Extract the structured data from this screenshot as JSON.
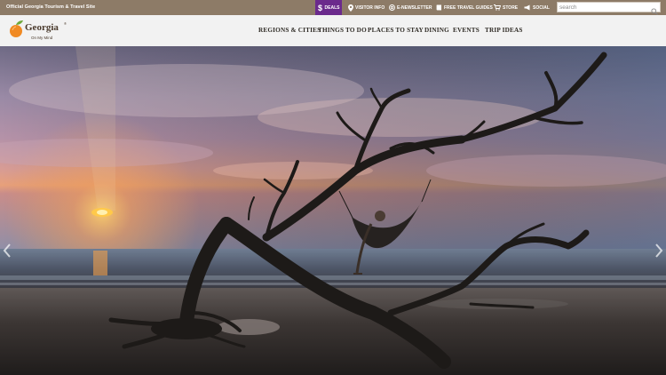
{
  "topbar": {
    "tagline": "Official Georgia Tourism & Travel Site",
    "links": {
      "deals": "DEALS",
      "visitor_info": "VISITOR INFO",
      "enewsletter": "E-NEWSLETTER",
      "travel_guides": "FREE TRAVEL GUIDES",
      "store": "STORE",
      "social": "SOCIAL"
    },
    "search": {
      "placeholder": "search",
      "value": ""
    }
  },
  "brand": {
    "name": "Georgia",
    "registered": "®",
    "slogan": "On My Mind"
  },
  "nav": {
    "items": [
      "REGIONS & CITIES",
      "THINGS TO DO",
      "PLACES TO STAY",
      "DINING",
      "EVENTS",
      "TRIP IDEAS"
    ]
  },
  "hero": {
    "icons": {
      "prev": "chevron-left-icon",
      "next": "chevron-right-icon"
    }
  },
  "colors": {
    "topbar": "#8d7b67",
    "deals_accent": "#6b2a8c",
    "peach": "#f08a24",
    "leaf": "#6ea83a",
    "nav_text": "#2e2a24"
  }
}
